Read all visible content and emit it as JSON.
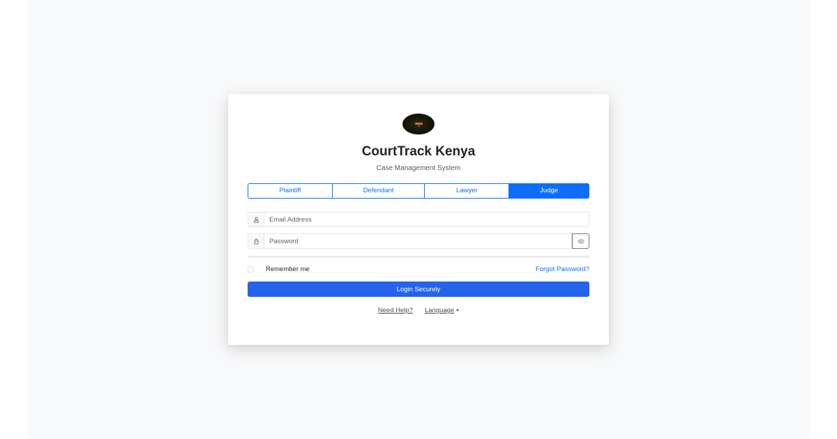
{
  "app": {
    "title": "CourtTrack Kenya",
    "subtitle": "Case Management System"
  },
  "roles": {
    "items": [
      "Plaintiff",
      "Defendant",
      "Lawyer",
      "Judge"
    ],
    "selected": "Judge"
  },
  "form": {
    "email_placeholder": "Email Address",
    "email_icon": "user-icon",
    "password_placeholder": "Password",
    "password_icon": "lock-icon",
    "toggle_icon": "eye-icon",
    "remember_label": "Remember me",
    "remember_checked": false,
    "forgot_label": "Forgot Password?",
    "submit_label": "Login Securely"
  },
  "footer": {
    "help_label": "Need Help?",
    "language_label": "Language"
  },
  "colors": {
    "primary": "#0d6efd",
    "submit": "#2563eb",
    "background": "#f8f9fa"
  }
}
